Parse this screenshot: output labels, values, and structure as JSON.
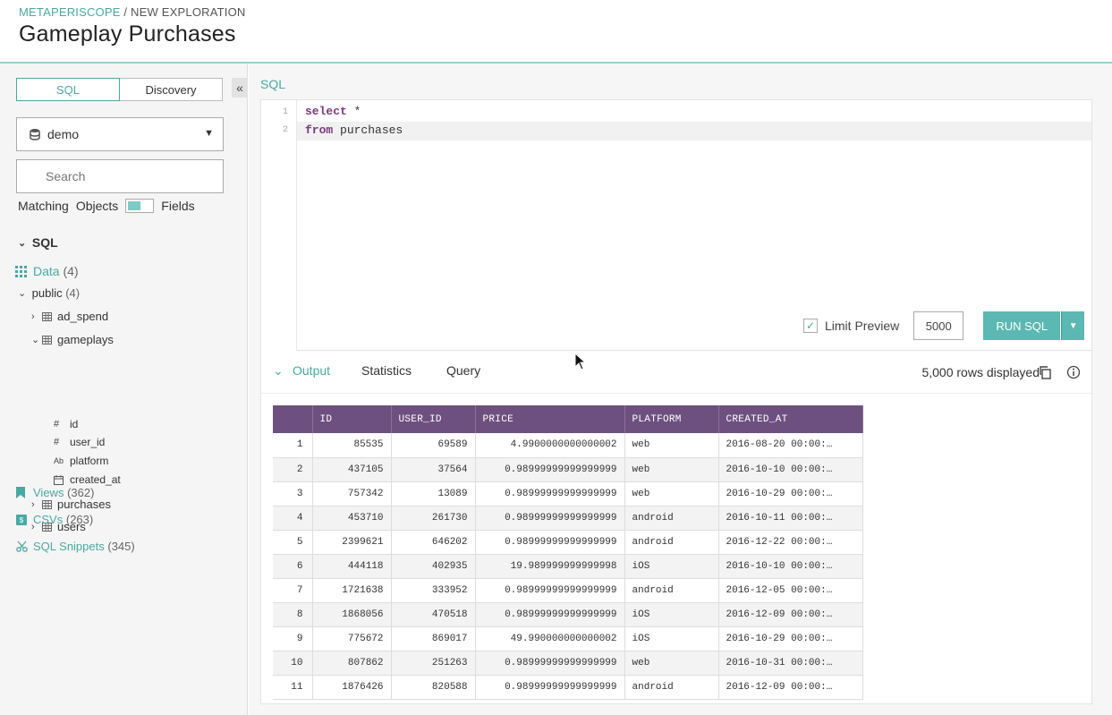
{
  "header": {
    "breadcrumb_link": "METAPERISCOPE",
    "breadcrumb_rest": " / NEW EXPLORATION",
    "title": "Gameplay Purchases"
  },
  "sidebar": {
    "seg_sql": "SQL",
    "seg_discovery": "Discovery",
    "collapse_glyph": "«",
    "database": "demo",
    "search_placeholder": "Search",
    "matching_label": "Matching",
    "objects_label": "Objects",
    "fields_label": "Fields",
    "section_sql": "SQL",
    "data": {
      "label": "Data",
      "count": "(4)"
    },
    "public": {
      "label": "public",
      "count": "(4)"
    },
    "tables": [
      "ad_spend",
      "gameplays",
      "purchases",
      "users"
    ],
    "fields": [
      {
        "icon": "#",
        "name": "id"
      },
      {
        "icon": "#",
        "name": "user_id"
      },
      {
        "icon": "Ab",
        "name": "platform"
      },
      {
        "icon": "cal",
        "name": "created_at"
      }
    ],
    "views": {
      "label": "Views",
      "count": "(362)"
    },
    "csvs": {
      "label": "CSVs",
      "count": "(263)"
    },
    "snippets": {
      "label": "SQL Snippets",
      "count": "(345)"
    }
  },
  "editor": {
    "label": "SQL",
    "lines": [
      {
        "num": "1",
        "kw": "select",
        "rest": " *"
      },
      {
        "num": "2",
        "kw": "from",
        "rest": " purchases"
      }
    ],
    "limit_label": "Limit Preview",
    "limit_value": "5000",
    "run_label": "RUN SQL"
  },
  "output": {
    "tabs": [
      "Output",
      "Statistics",
      "Query"
    ],
    "rows_displayed": "5,000 rows displayed",
    "columns": [
      "",
      "ID",
      "USER_ID",
      "PRICE",
      "PLATFORM",
      "CREATED_AT"
    ],
    "rows": [
      [
        "1",
        "85535",
        "69589",
        "4.9900000000000002",
        "web",
        "2016-08-20 00:00:…"
      ],
      [
        "2",
        "437105",
        "37564",
        "0.98999999999999999",
        "web",
        "2016-10-10 00:00:…"
      ],
      [
        "3",
        "757342",
        "13089",
        "0.98999999999999999",
        "web",
        "2016-10-29 00:00:…"
      ],
      [
        "4",
        "453710",
        "261730",
        "0.98999999999999999",
        "android",
        "2016-10-11 00:00:…"
      ],
      [
        "5",
        "2399621",
        "646202",
        "0.98999999999999999",
        "android",
        "2016-12-22 00:00:…"
      ],
      [
        "6",
        "444118",
        "402935",
        "19.989999999999998",
        "iOS",
        "2016-10-10 00:00:…"
      ],
      [
        "7",
        "1721638",
        "333952",
        "0.98999999999999999",
        "android",
        "2016-12-05 00:00:…"
      ],
      [
        "8",
        "1868056",
        "470518",
        "0.98999999999999999",
        "iOS",
        "2016-12-09 00:00:…"
      ],
      [
        "9",
        "775672",
        "869017",
        "49.990000000000002",
        "iOS",
        "2016-10-29 00:00:…"
      ],
      [
        "10",
        "807862",
        "251263",
        "0.98999999999999999",
        "web",
        "2016-10-31 00:00:…"
      ],
      [
        "11",
        "1876426",
        "820588",
        "0.98999999999999999",
        "android",
        "2016-12-09 00:00:…"
      ]
    ]
  },
  "colors": {
    "accent": "#4aa8a3",
    "table_header": "#6e5080",
    "run_button": "#5cb8b2"
  }
}
